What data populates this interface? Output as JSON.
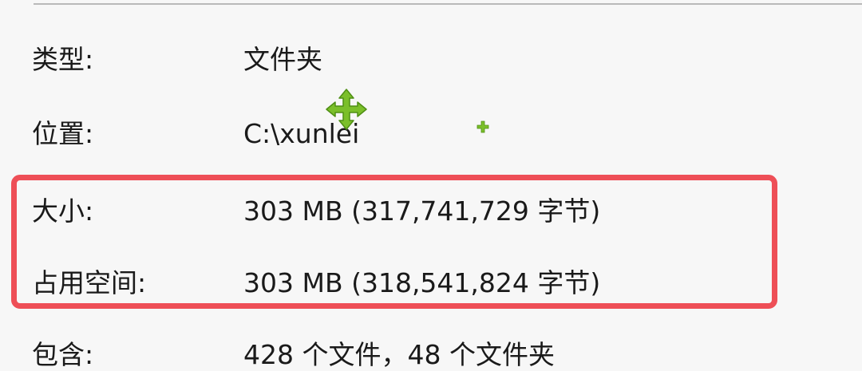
{
  "properties": [
    {
      "label": "类型:",
      "value": "文件夹"
    },
    {
      "label": "位置:",
      "value": "C:\\xunlei"
    },
    {
      "label": "大小:",
      "value": "303 MB (317,741,729 字节)"
    },
    {
      "label": "占用空间:",
      "value": "303 MB (318,541,824 字节)"
    },
    {
      "label": "包含:",
      "value": "428 个文件，48 个文件夹"
    }
  ],
  "colors": {
    "highlight": "#ee4f57",
    "cursor": "#7bbf2a"
  },
  "icons": {
    "cursor": "move-cursor-icon",
    "marker": "plus-marker-icon"
  }
}
